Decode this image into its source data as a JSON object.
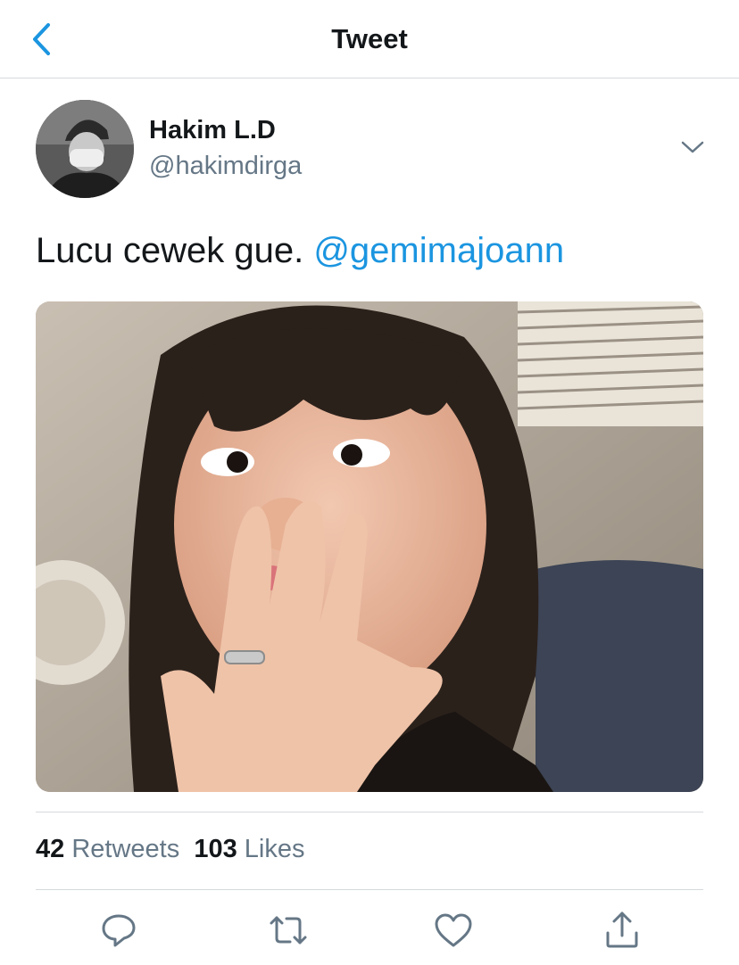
{
  "header": {
    "title": "Tweet",
    "back_icon": "chevron-left-icon"
  },
  "author": {
    "display_name": "Hakim L.D",
    "handle": "@hakimdirga"
  },
  "tweet": {
    "text": "Lucu cewek gue.",
    "mention": "@gemimajoann"
  },
  "stats": {
    "retweets_count": "42",
    "retweets_label": "Retweets",
    "likes_count": "103",
    "likes_label": "Likes"
  },
  "actions": [
    "reply-icon",
    "retweet-icon",
    "like-icon",
    "share-icon"
  ],
  "colors": {
    "accent": "#1b95e0",
    "secondary_text": "#657786",
    "divider": "#d5d9dd",
    "icon": "#657786"
  }
}
